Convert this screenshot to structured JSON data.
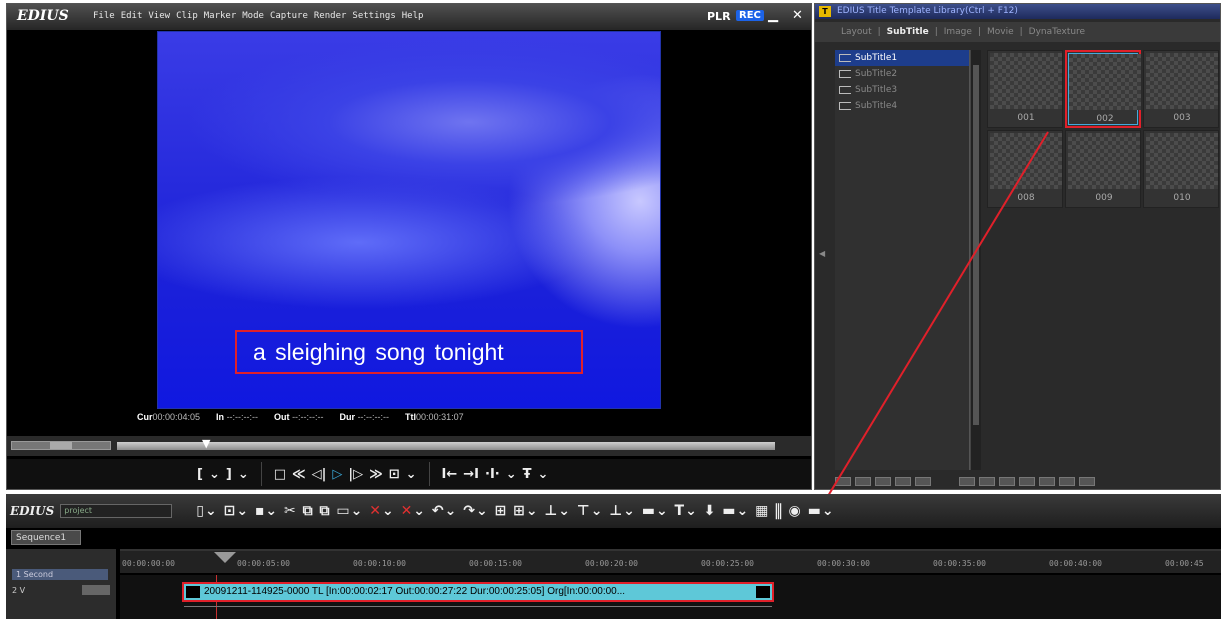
{
  "player": {
    "app_name": "EDIUS",
    "menu": [
      "File",
      "Edit",
      "View",
      "Clip",
      "Marker",
      "Mode",
      "Capture",
      "Render",
      "Settings",
      "Help"
    ],
    "plr": "PLR",
    "rec": "REC",
    "caption": "a sleighing song tonight",
    "cur_label": "Cur",
    "cur_value": "00:00:04:05",
    "in_label": "In",
    "in_value": "--:--:--:--",
    "out_label": "Out",
    "out_value": "--:--:--:--",
    "dur_label": "Dur",
    "dur_value": "--:--:--:--",
    "ttl_label": "Ttl",
    "ttl_value": "00:00:31:07"
  },
  "library": {
    "title": "EDIUS Title Template Library(Ctrl + F12)",
    "tabs": [
      "Layout",
      "SubTitle",
      "Image",
      "Movie",
      "DynaTexture"
    ],
    "active_tab": "SubTitle",
    "tree": [
      "SubTitle1",
      "SubTitle2",
      "SubTitle3",
      "SubTitle4"
    ],
    "thumbs": [
      "001",
      "002",
      "003",
      "008",
      "009",
      "010"
    ]
  },
  "timeline": {
    "app_name": "EDIUS",
    "project": "project",
    "sequence": "Sequence1",
    "scale": "1 Second",
    "track": "2 V",
    "ruler": [
      "00:00:00:00",
      "00:00:05:00",
      "00:00:10:00",
      "00:00:15:00",
      "00:00:20:00",
      "00:00:25:00",
      "00:00:30:00",
      "00:00:35:00",
      "00:00:40:00",
      "00:00:45"
    ],
    "clip_text": "20091211-114925-0000  TL [In:00:00:02:17 Out:00:00:27:22 Dur:00:00:25:05]  Org[In:00:00:00..."
  },
  "colors": {
    "highlight": "#e0202a",
    "clip": "#5ec8d8",
    "selection": "#1d3d8c"
  }
}
